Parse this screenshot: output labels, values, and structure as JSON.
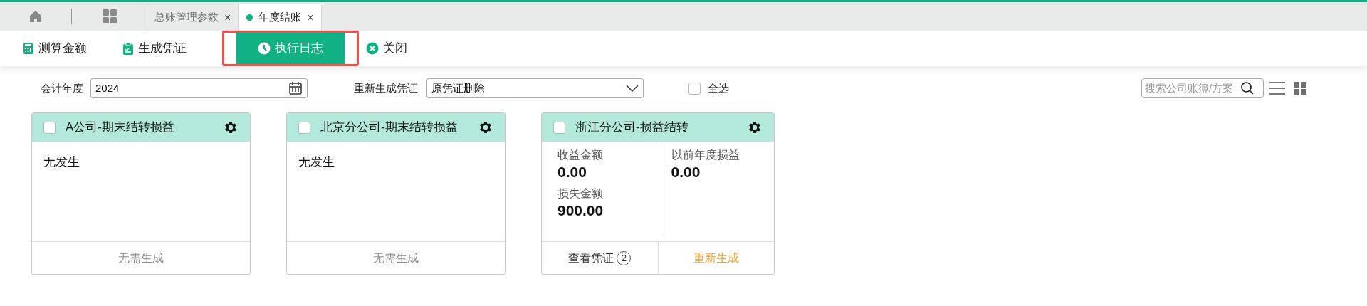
{
  "tabs": [
    {
      "label": "总账管理参数",
      "selected": false,
      "dot": false,
      "close": "×"
    },
    {
      "label": "年度结账",
      "selected": true,
      "dot": true,
      "close": "×"
    }
  ],
  "toolbar": [
    {
      "label": "测算金额",
      "primary": false,
      "highlighted": false
    },
    {
      "label": "生成凭证",
      "primary": false,
      "highlighted": false
    },
    {
      "label": "执行日志",
      "primary": true,
      "highlighted": true
    },
    {
      "label": "关闭",
      "primary": false,
      "highlighted": false
    }
  ],
  "filters": {
    "year_label": "会计年度",
    "year_value": "2024",
    "regen_label": "重新生成凭证",
    "regen_value": "原凭证删除",
    "select_all": {
      "label": "全选",
      "checked": false
    },
    "search": {
      "placeholder": "搜索公司账簿/方案"
    }
  },
  "cards": [
    {
      "kind": "empty",
      "title": "A公司-期末结转损益",
      "checked": false,
      "message": "无发生",
      "footer": [
        {
          "label": "无需生成",
          "kind": "disabled"
        }
      ]
    },
    {
      "kind": "empty",
      "title": "北京分公司-期末结转损益",
      "checked": false,
      "message": "无发生",
      "footer": [
        {
          "label": "无需生成",
          "kind": "disabled"
        }
      ]
    },
    {
      "kind": "amounts",
      "title": "浙江分公司-损益结转",
      "checked": false,
      "left": [
        {
          "label": "收益金额",
          "value": "0.00"
        },
        {
          "label": "损失金额",
          "value": "900.00"
        }
      ],
      "right": [
        {
          "label": "以前年度损益",
          "value": "0.00"
        }
      ],
      "footer": [
        {
          "label": "查看凭证",
          "kind": "plain",
          "count": "2"
        },
        {
          "label": "重新生成",
          "kind": "accent"
        }
      ]
    }
  ]
}
